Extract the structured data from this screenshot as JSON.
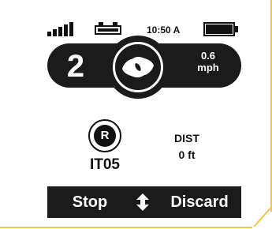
{
  "status_bar": {
    "time": "10:50 A",
    "signal_icon": "signal-strength-icon",
    "vehicle_battery_icon": "vehicle-battery-icon",
    "device_battery_icon": "device-battery-icon"
  },
  "drive": {
    "gear": "2",
    "center_icon": "rotation-swirl-icon",
    "speed_value": "0.6",
    "speed_unit": "mph"
  },
  "info": {
    "mode_letter": "R",
    "item_code": "IT05",
    "dist_label": "DIST",
    "dist_value": "0 ft"
  },
  "actions": {
    "stop_label": "Stop",
    "discard_label": "Discard",
    "scroll_icon": "up-down-arrows-icon"
  },
  "colors": {
    "frame_accent": "#f5c242",
    "bar_background": "#1b1b1b",
    "text_light": "#ffffff",
    "text_dark": "#111111"
  }
}
